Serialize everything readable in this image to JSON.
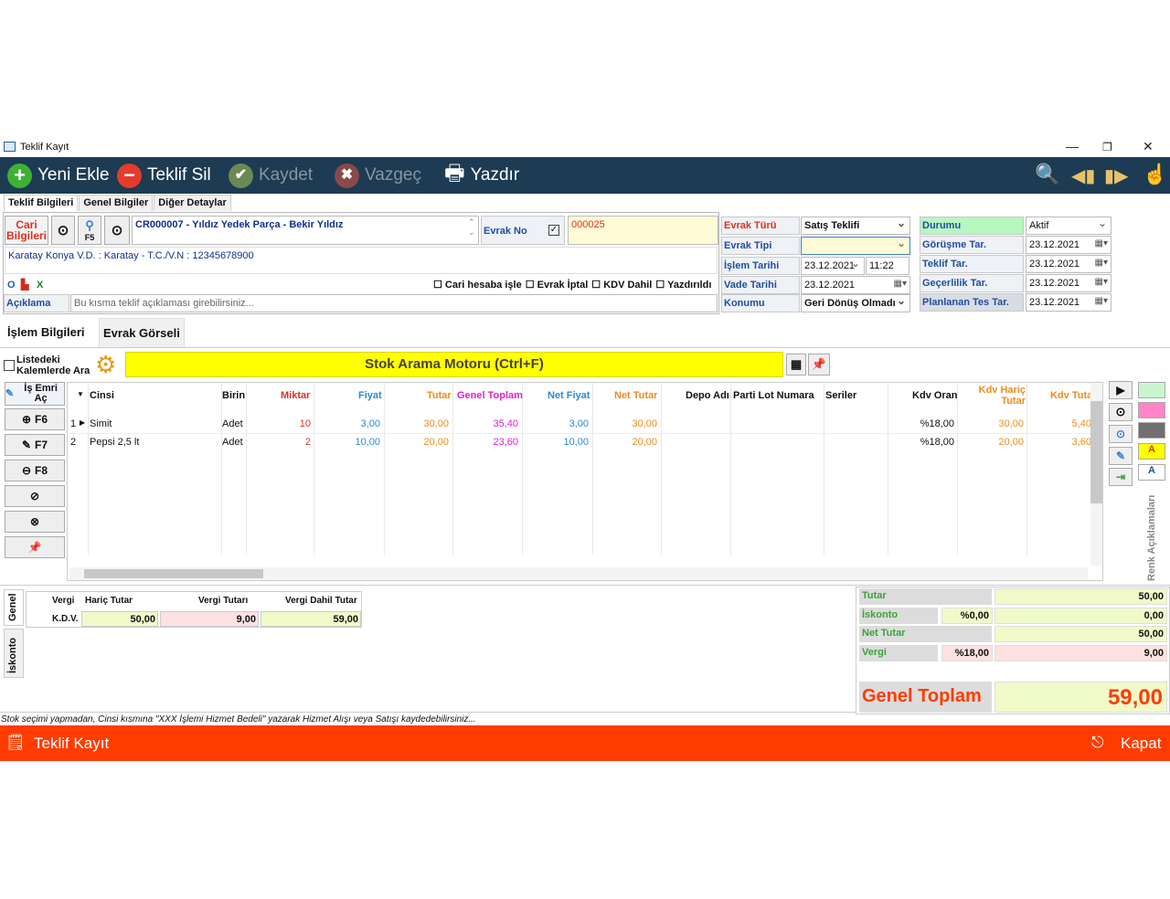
{
  "window": {
    "title": "Teklif Kayıt",
    "min": "—",
    "max": "❐",
    "close": "✕"
  },
  "toolbar": {
    "new": "Yeni Ekle",
    "delete": "Teklif Sil",
    "save": "Kaydet",
    "cancel": "Vazgeç",
    "print": "Yazdır"
  },
  "tabs": [
    "Teklif Bilgileri",
    "Genel Bilgiler",
    "Diğer Detaylar"
  ],
  "cari": {
    "label": "Cari Bilgileri",
    "f5": "F5",
    "name": "CR000007 - Yıldız Yedek Parça - Bekir Yıldız",
    "address": "Karatay Konya V.D. :  Karatay - T.C./V.N :  12345678900"
  },
  "evrak_no": {
    "label": "Evrak No",
    "value": "000025"
  },
  "checks": {
    "cari": "Cari hesaba işle",
    "iptal": "Evrak İptal",
    "kdv": "KDV Dahil",
    "yazdirildi": "Yazdırıldı"
  },
  "aciklama": {
    "label": "Açıklama",
    "placeholder": "Bu kısma teklif açıklaması girebilirsiniz..."
  },
  "mid": {
    "evrak_turu_l": "Evrak Türü",
    "evrak_turu": "Satış Teklifi",
    "evrak_tipi_l": "Evrak Tipi",
    "islem_l": "İşlem Tarihi",
    "islem": "23.12.2021",
    "islem_saat": "11:22",
    "vade_l": "Vade Tarihi",
    "vade": "23.12.2021",
    "konum_l": "Konumu",
    "konum": "Geri Dönüş Olmadı"
  },
  "right": {
    "durum_l": "Durumu",
    "durum": "Aktif",
    "gorusme_l": "Görüşme Tar.",
    "gorusme": "23.12.2021",
    "teklif_l": "Teklif Tar.",
    "teklif": "23.12.2021",
    "gecerlilik_l": "Geçerlilik Tar.",
    "gecerlilik": "23.12.2021",
    "planlanan_l": "Planlanan Tes Tar.",
    "planlanan": "23.12.2021"
  },
  "tabs2": [
    "İşlem Bilgileri",
    "Evrak Görseli"
  ],
  "search": {
    "list_label": "Listedeki Kalemlerde Ara",
    "title": "Stok Arama Motoru (Ctrl+F)"
  },
  "side": {
    "is_emri": "İş Emri Aç",
    "f6": "F6",
    "f7": "F7",
    "f8": "F8"
  },
  "columns": [
    "Cinsi",
    "Birin",
    "Miktar",
    "Fiyat",
    "Tutar",
    "Genel Toplam",
    "Net Fiyat",
    "Net Tutar",
    "Depo Adı",
    "Parti Lot Numara",
    "Seriler",
    "Kdv Oran",
    "Kdv Hariç Tutar",
    "Kdv Tuta"
  ],
  "rows": [
    {
      "no": "1",
      "cinsi": "Simit",
      "birim": "Adet",
      "miktar": "10",
      "fiyat": "3,00",
      "tutar": "30,00",
      "genel": "35,40",
      "net_fiyat": "3,00",
      "net_tutar": "30,00",
      "kdv": "%18,00",
      "kdv_haric": "30,00",
      "kdv_tutar": "5,40"
    },
    {
      "no": "2",
      "cinsi": "Pepsi 2,5 lt",
      "birim": "Adet",
      "miktar": "2",
      "fiyat": "10,00",
      "tutar": "20,00",
      "genel": "23,60",
      "net_fiyat": "10,00",
      "net_tutar": "20,00",
      "kdv": "%18,00",
      "kdv_haric": "20,00",
      "kdv_tutar": "3,60"
    }
  ],
  "renk": "Renk Açıklamaları",
  "vtabs": [
    "Genel",
    "İskonto"
  ],
  "vergi": {
    "h1": "Vergi",
    "h2": "Hariç Tutar",
    "h3": "Vergi Tutarı",
    "h4": "Vergi Dahil Tutar",
    "name": "K.D.V.",
    "haric": "50,00",
    "tutar": "9,00",
    "dahil": "59,00"
  },
  "totals": {
    "tutar_l": "Tutar",
    "tutar": "50,00",
    "iskonto_l": "İskonto",
    "iskonto_p": "%0,00",
    "iskonto": "0,00",
    "net_l": "Net Tutar",
    "net": "50,00",
    "vergi_l": "Vergi",
    "vergi_p": "%18,00",
    "vergi": "9,00",
    "genel_l": "Genel Toplam",
    "genel": "59,00"
  },
  "hint": "Stok seçimi yapmadan, Cinsi kısmına \"XXX İşlemi Hizmet Bedeli\" yazarak Hizmet Alışı veya Satışı kaydedebilirsiniz...",
  "status": {
    "title": "Teklif Kayıt",
    "close": "Kapat"
  }
}
